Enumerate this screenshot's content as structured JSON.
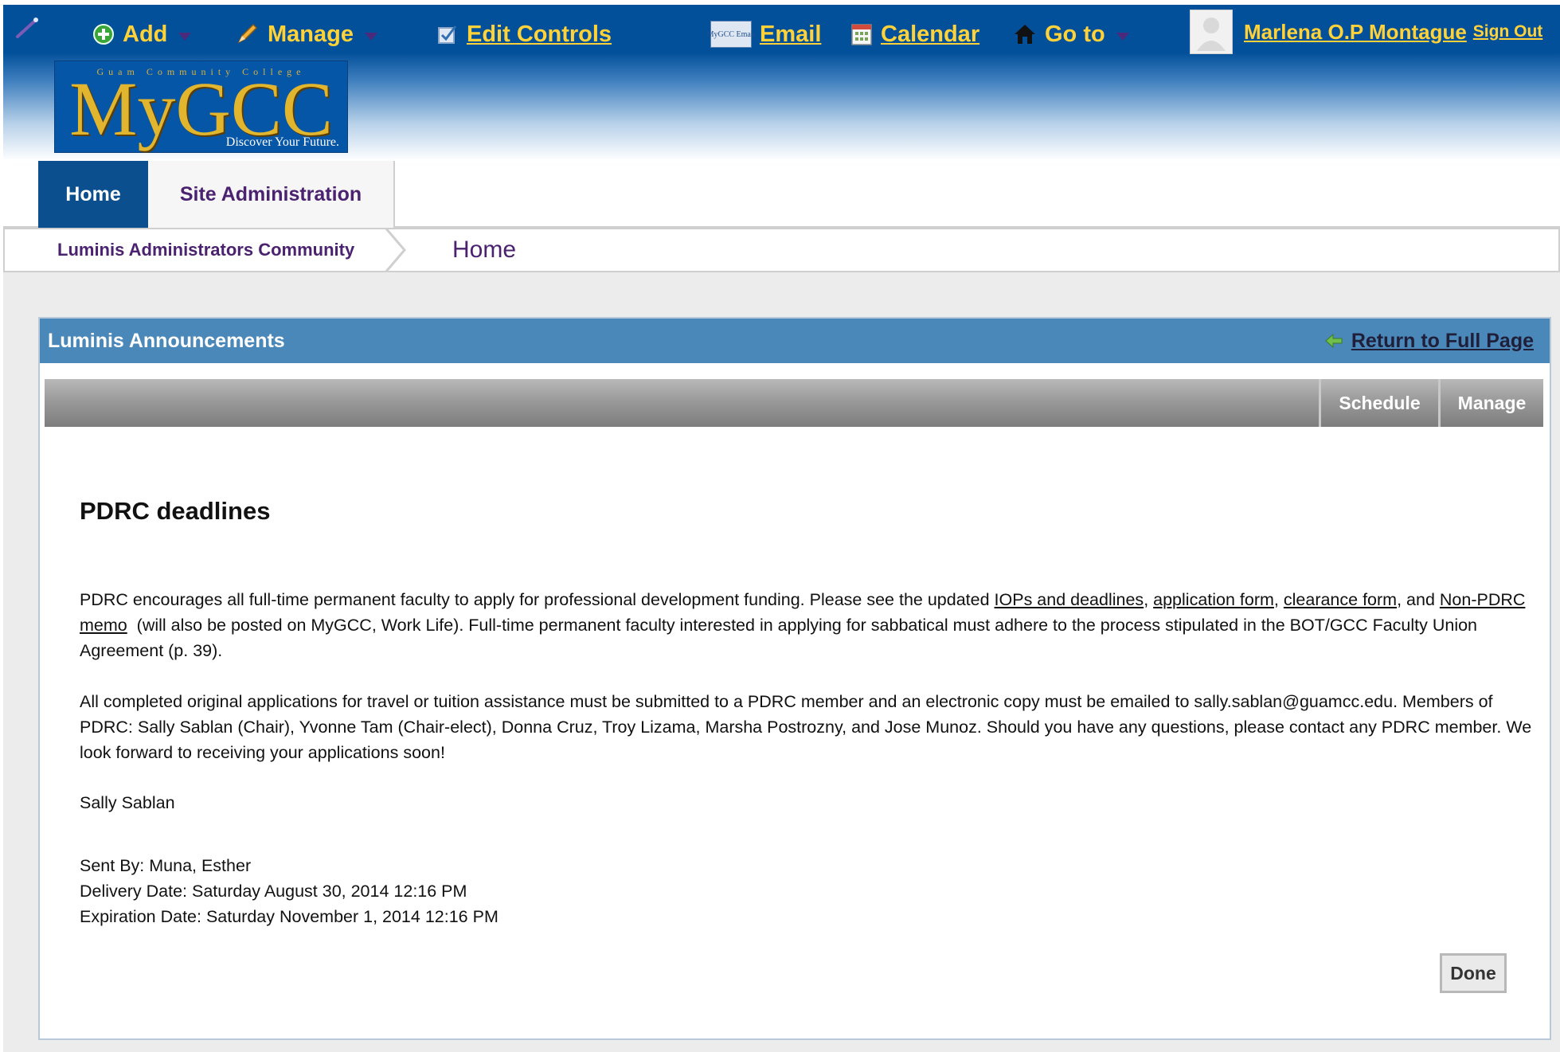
{
  "top_bar": {
    "add_label": "Add",
    "manage_label": "Manage",
    "edit_controls_label": "Edit Controls",
    "email_label": "Email",
    "email_icon_text": "MyGCC Email",
    "calendar_label": "Calendar",
    "goto_label": "Go to",
    "user_name": "Marlena O.P Montague",
    "sign_out_label": "Sign Out"
  },
  "logo": {
    "tagline": "Guam Community College",
    "name": "MyGCC",
    "slogan": "Discover Your Future."
  },
  "tabs": [
    {
      "label": "Home",
      "active": true
    },
    {
      "label": "Site Administration",
      "active": false
    }
  ],
  "breadcrumb": {
    "community": "Luminis Administrators Community",
    "current": "Home"
  },
  "panel": {
    "title": "Luminis Announcements",
    "return_label": "Return to Full Page",
    "toolbar": {
      "schedule_label": "Schedule",
      "manage_label": "Manage"
    }
  },
  "announcement": {
    "title": "PDRC deadlines",
    "p1": {
      "intro": "PDRC encourages all full-time permanent faculty to apply for professional development funding. Please see the updated ",
      "link_iops": "IOPs and deadlines",
      "sep1": ", ",
      "link_application": "application form",
      "sep2": ", ",
      "link_clearance": "clearance form",
      "sep3": ", and ",
      "link_memo": "Non-PDRC memo",
      "rest": "  (will also be posted on MyGCC, Work Life). Full-time permanent faculty interested in applying for sabbatical must adhere to the process stipulated in the BOT/GCC Faculty Union Agreement (p. 39)."
    },
    "p2": "All completed original applications for travel or tuition assistance must be submitted to a PDRC member and an electronic copy must be emailed to sally.sablan@guamcc.edu. Members of PDRC: Sally Sablan (Chair), Yvonne Tam (Chair-elect), Donna Cruz, Troy Lizama, Marsha Postrozny, and Jose Munoz. Should you have any questions, please contact any PDRC member. We look forward to receiving your applications soon!",
    "signature": "Sally Sablan",
    "sent_by": "Sent By: Muna, Esther",
    "delivery_date": "Delivery Date: Saturday August 30, 2014 12:16 PM",
    "expiration_date": "Expiration Date: Saturday November 1, 2014 12:16 PM"
  },
  "done_label": "Done",
  "colors": {
    "header_blue": "#02509a",
    "toolbar_gold": "#ffd23a",
    "panel_header": "#4b88ba",
    "tab_active": "#0b4f8f",
    "purple_text": "#4b2270"
  }
}
